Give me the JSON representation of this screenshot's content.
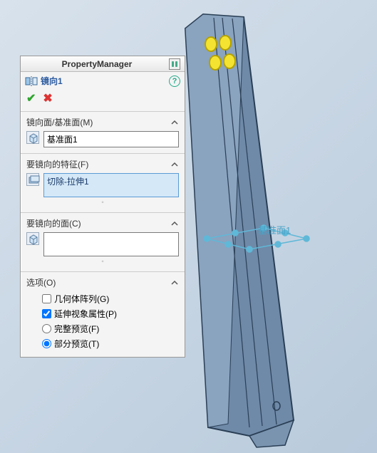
{
  "header": {
    "title": "PropertyManager"
  },
  "feature": {
    "name": "镜向1"
  },
  "sections": {
    "mirror_plane": {
      "label": "镜向面/基准面(M)",
      "value": "基准面1"
    },
    "features_to_mirror": {
      "label": "要镜向的特征(F)",
      "value": "切除-拉伸1"
    },
    "faces_to_mirror": {
      "label": "要镜向的面(C)",
      "value": ""
    },
    "options": {
      "label": "选项(O)",
      "geometry_pattern": "几何体阵列(G)",
      "propagate_visual": "延伸视象属性(P)",
      "full_preview": "完整预览(F)",
      "partial_preview": "部分预览(T)"
    }
  },
  "icons": {
    "mirror": "mirror-icon",
    "cube": "cube-icon",
    "feature": "feature-icon",
    "help": "help-icon",
    "pin": "pin-icon",
    "chevron_up": "chevron-up-icon"
  },
  "state": {
    "geometry_pattern_checked": false,
    "propagate_visual_checked": true,
    "preview_mode": "partial"
  },
  "colors": {
    "accent_blue": "#2a5aa0",
    "ok_green": "#2fa52f",
    "cancel_red": "#d33",
    "selection_hl": "#d4e8f7"
  }
}
